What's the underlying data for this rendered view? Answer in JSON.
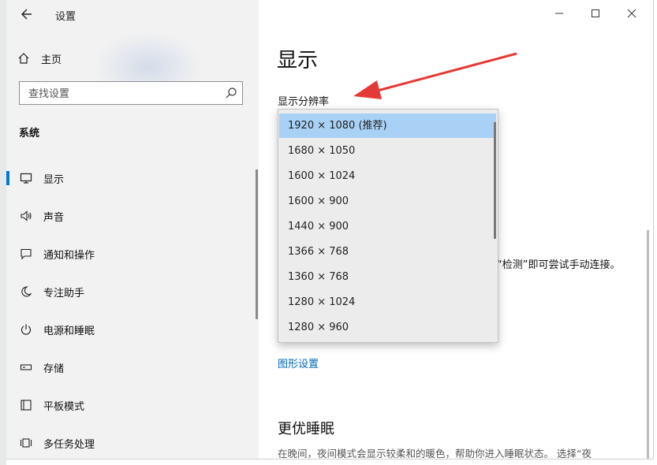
{
  "window": {
    "title": "设置",
    "controls": {
      "minimize": "—",
      "maximize": "☐",
      "close": "✕"
    }
  },
  "sidebar": {
    "home_label": "主页",
    "search_placeholder": "查找设置",
    "section_label": "系统",
    "items": [
      {
        "label": "显示",
        "icon": "monitor-icon",
        "selected": true
      },
      {
        "label": "声音",
        "icon": "speaker-icon"
      },
      {
        "label": "通知和操作",
        "icon": "notification-icon"
      },
      {
        "label": "专注助手",
        "icon": "moon-icon"
      },
      {
        "label": "电源和睡眠",
        "icon": "power-icon"
      },
      {
        "label": "存储",
        "icon": "storage-icon"
      },
      {
        "label": "平板模式",
        "icon": "tablet-icon"
      },
      {
        "label": "多任务处理",
        "icon": "multitask-icon"
      }
    ]
  },
  "main": {
    "title": "显示",
    "resolution_label": "显示分辨率",
    "resolution_options": [
      "1920 × 1080 (推荐)",
      "1680 × 1050",
      "1600 × 1024",
      "1600 × 900",
      "1440 × 900",
      "1366 × 768",
      "1360 × 768",
      "1280 × 1024",
      "1280 × 960"
    ],
    "selected_option": "1920 × 1080 (推荐)",
    "detect_text": "“检测”即可尝试手动连接。",
    "graphics_link": "图形设置",
    "night_light_title": "更优睡眠",
    "night_light_desc": "在晚间，夜间模式会显示较柔和的暖色，帮助你进入睡眠状态。 选择“夜"
  },
  "colors": {
    "accent": "#0078d7",
    "selected_bg": "#a8d1f5",
    "arrow": "#e53935",
    "link": "#0067b8"
  }
}
